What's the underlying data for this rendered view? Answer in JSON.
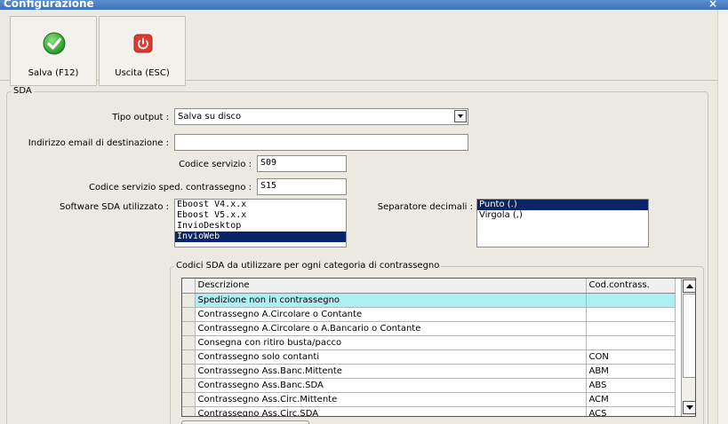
{
  "window": {
    "title": "Configurazione",
    "close": "×"
  },
  "toolbar": {
    "save_label": "Salva (F12)",
    "exit_label": "Uscita (ESC)",
    "save_icon": "check-circle-icon",
    "exit_icon": "power-icon",
    "colors": {
      "save": "#2fa82f",
      "exit": "#e03a2f"
    }
  },
  "sda": {
    "group_title": "SDA",
    "tipo_output": {
      "label": "Tipo output :",
      "value": "Salva su disco"
    },
    "email": {
      "label": "Indirizzo email di destinazione :",
      "value": ""
    },
    "codice_servizio": {
      "label": "Codice servizio :",
      "value": "S09"
    },
    "codice_contrassegno": {
      "label": "Codice servizio sped. contrassegno :",
      "value": "S15"
    },
    "software": {
      "label": "Software SDA utilizzato :",
      "options": [
        "Eboost V4.x.x",
        "Eboost V5.x.x",
        "InvioDesktop",
        "InvioWeb"
      ],
      "selected": "InvioWeb"
    },
    "separatore": {
      "label": "Separatore decimali :",
      "options": [
        "Punto (.)",
        "Virgola (,)"
      ],
      "selected": "Punto (.)"
    },
    "codici": {
      "group_title": "Codici SDA da utilizzare per ogni categoria di contrassegno",
      "columns": [
        "Descrizione",
        "Cod.contrass."
      ],
      "rows": [
        {
          "descrizione": "Spedizione non in contrassegno",
          "codice": ""
        },
        {
          "descrizione": "Contrassegno A.Circolare o Contante",
          "codice": ""
        },
        {
          "descrizione": "Contrassegno A.Circolare o A.Bancario o Contante",
          "codice": ""
        },
        {
          "descrizione": "Consegna con ritiro busta/pacco",
          "codice": ""
        },
        {
          "descrizione": "Contrassegno solo contanti",
          "codice": "CON"
        },
        {
          "descrizione": "Contrassegno Ass.Banc.Mittente",
          "codice": "ABM"
        },
        {
          "descrizione": "Contrassegno Ass.Banc.SDA",
          "codice": "ABS"
        },
        {
          "descrizione": "Contrassegno Ass.Circ.Mittente",
          "codice": "ACM"
        },
        {
          "descrizione": "Contrassegno Ass.Circ.SDA",
          "codice": "ACS"
        }
      ]
    }
  }
}
